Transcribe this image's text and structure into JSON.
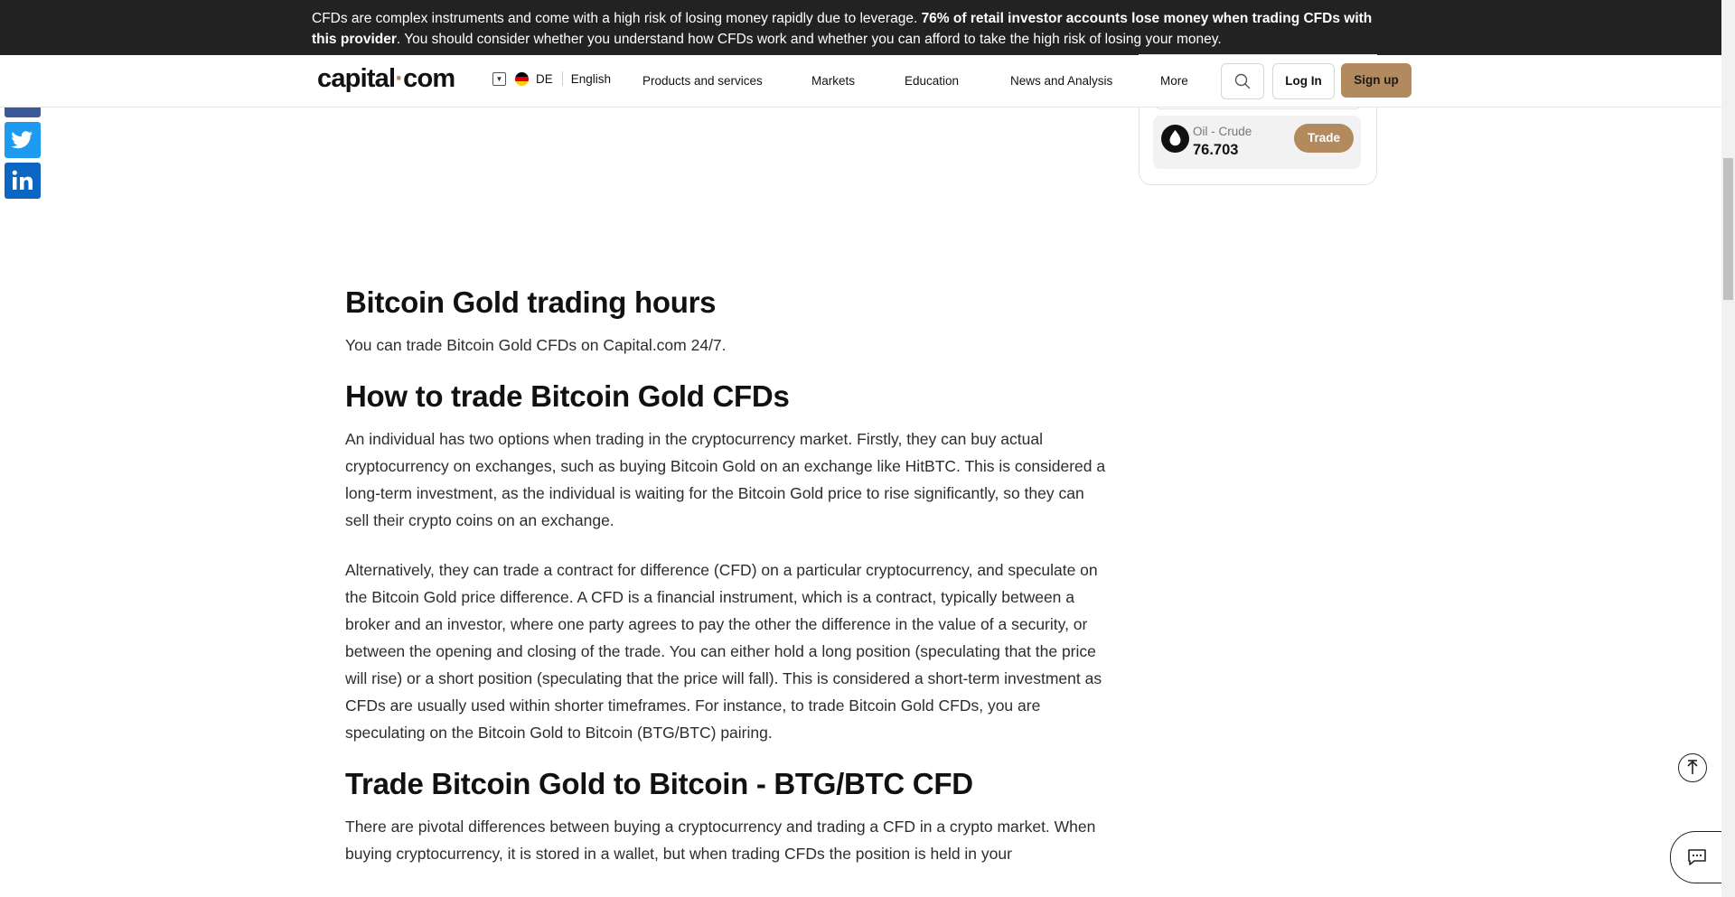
{
  "risk_banner": {
    "text_start": "CFDs are complex instruments and come with a high risk of losing money rapidly due to leverage. ",
    "text_bold": "76% of retail investor accounts lose money when trading CFDs with this provider",
    "text_end": ". You should consider whether you understand how CFDs work and whether you can afford to take the high risk of losing your money."
  },
  "header": {
    "logo_main": "capital",
    "logo_dot": "·",
    "logo_end": "com",
    "country_code": "DE",
    "language": "English",
    "nav": [
      "Products and services",
      "Markets",
      "Education",
      "News and Analysis",
      "More"
    ],
    "login_label": "Log In",
    "signup_label": "Sign up"
  },
  "sidebar_widget": {
    "instrument_name": "Oil - Crude",
    "instrument_price": "76.703",
    "trade_label": "Trade"
  },
  "article": {
    "h_trading_hours": "Bitcoin Gold trading hours",
    "p_trading_hours": "You can trade Bitcoin Gold CFDs on Capital.com 24/7.",
    "h_how_to_trade": "How to trade Bitcoin Gold CFDs",
    "p_how_1": "An individual has two options when trading in the cryptocurrency market. Firstly, they can buy actual cryptocurrency on exchanges, such as buying Bitcoin Gold on an exchange like HitBTC. This is considered a long-term investment, as the individual is waiting for the Bitcoin Gold price to rise significantly, so they can sell their crypto coins on an exchange.",
    "p_how_2": "Alternatively, they can trade a contract for difference (CFD) on a particular cryptocurrency, and speculate on the Bitcoin Gold price difference. A CFD is a financial instrument, which is a contract, typically between a broker and an investor, where one party agrees to pay the other the difference in the value of a security, or between the opening and closing of the trade. You can either hold a long position (speculating that the price will rise) or a short position (speculating that the price will fall). This is considered a short-term investment as CFDs are usually used within shorter timeframes. For instance, to trade Bitcoin Gold CFDs, you are speculating on the Bitcoin Gold to Bitcoin (BTG/BTC) pairing.",
    "h_btg_btc": "Trade Bitcoin Gold to Bitcoin - BTG/BTC CFD",
    "p_btg_btc": "There are pivotal differences between buying a cryptocurrency and trading a CFD in a crypto market. When buying cryptocurrency, it is stored in a wallet, but when trading CFDs the position  is held in your"
  },
  "icons": {
    "social": [
      "facebook-icon",
      "twitter-icon",
      "linkedin-icon"
    ],
    "search": "search-icon",
    "back_to_top": "arrow-up-icon",
    "chat": "chat-icon",
    "oil": "oil-drop-icon"
  },
  "colors": {
    "banner_bg": "#222222",
    "accent": "#b3895e",
    "facebook": "#3b5998",
    "twitter": "#1da1f2",
    "linkedin": "#0a66c2"
  }
}
